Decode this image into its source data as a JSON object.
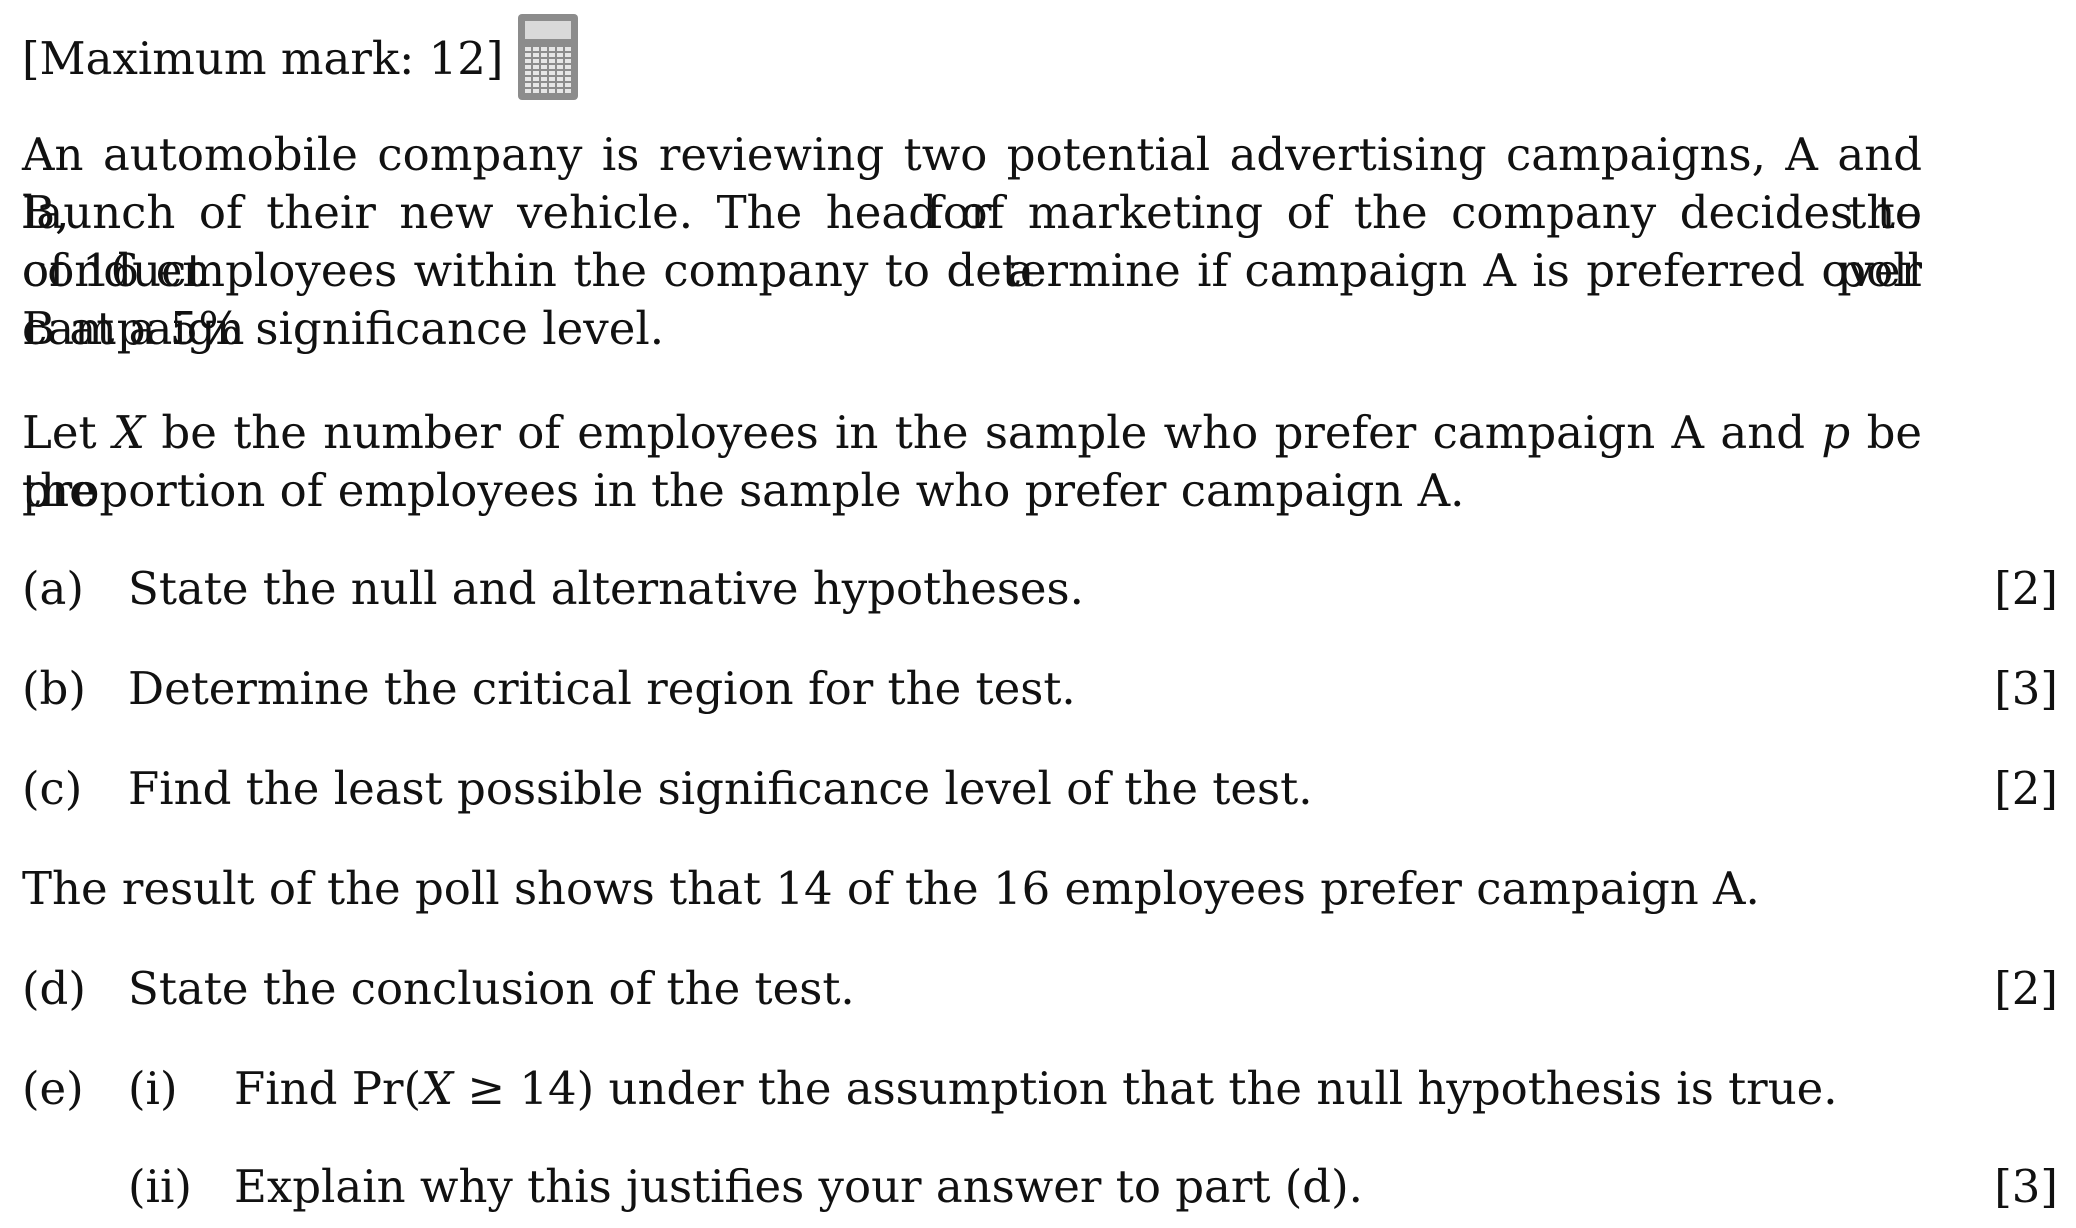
{
  "header": {
    "max_mark": "[Maximum mark: 12]",
    "calculator_icon": "calculator-icon"
  },
  "intro": {
    "line1": "An automobile company is reviewing two potential advertising campaigns, A and B, for the",
    "line2": "launch of their new vehicle. The head of marketing of the company decides to conduct a poll",
    "line3": "of 16 employees within the company to determine if campaign A is preferred over campaign",
    "line4": "B at a 5% significance level."
  },
  "definition": {
    "line1_a": "Let",
    "line1_var_x": "X",
    "line1_b": "be the number of employees in the sample who prefer campaign A and",
    "line1_var_p": "p",
    "line1_c": "be the",
    "line2": "proportion of employees in the sample who prefer campaign A."
  },
  "parts": {
    "a": {
      "label": "(a)",
      "text": "State the null and alternative hypotheses.",
      "mark": "[2]"
    },
    "b": {
      "label": "(b)",
      "text": "Determine the critical region for the test.",
      "mark": "[3]"
    },
    "c": {
      "label": "(c)",
      "text": "Find the least possible significance level of the test.",
      "mark": "[2]"
    },
    "result": "The result of the poll shows that 14 of the 16 employees prefer campaign A.",
    "d": {
      "label": "(d)",
      "text": "State the conclusion of the test.",
      "mark": "[2]"
    },
    "e": {
      "label": "(e)",
      "i_label": "(i)",
      "i_text_a": "Find Pr(",
      "i_var": "X",
      "i_text_b": " ≥ 14) under the assumption that the null hypothesis is true.",
      "ii_label": "(ii)",
      "ii_text": "Explain why this justifies your answer to part (d).",
      "mark": "[3]"
    }
  }
}
